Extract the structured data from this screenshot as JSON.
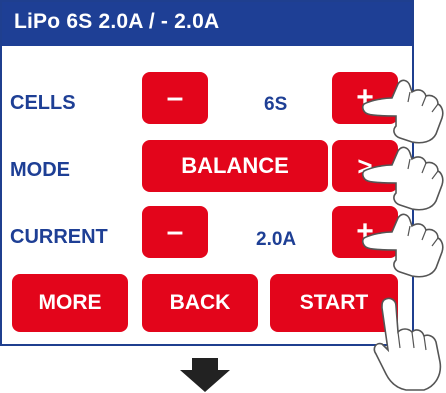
{
  "header": {
    "title": "LiPo  6S   2.0A / - 2.0A"
  },
  "rows": {
    "cells": {
      "label": "CELLS",
      "minus": "–",
      "value": "6S",
      "plus": "+"
    },
    "mode": {
      "label": "MODE",
      "mode_value": "BALANCE",
      "next": ">"
    },
    "current": {
      "label": "CURRENT",
      "minus": "–",
      "value": "2.0A",
      "plus": "+"
    }
  },
  "footer": {
    "more": "MORE",
    "back": "BACK",
    "start": "START"
  },
  "icons": {
    "pointer": "hand-pointer-icon",
    "arrow": "arrow-down-icon"
  },
  "colors": {
    "header_bg": "#1e3f95",
    "button_bg": "#e3051b",
    "label": "#1e3f95",
    "button_text": "#ffffff"
  }
}
